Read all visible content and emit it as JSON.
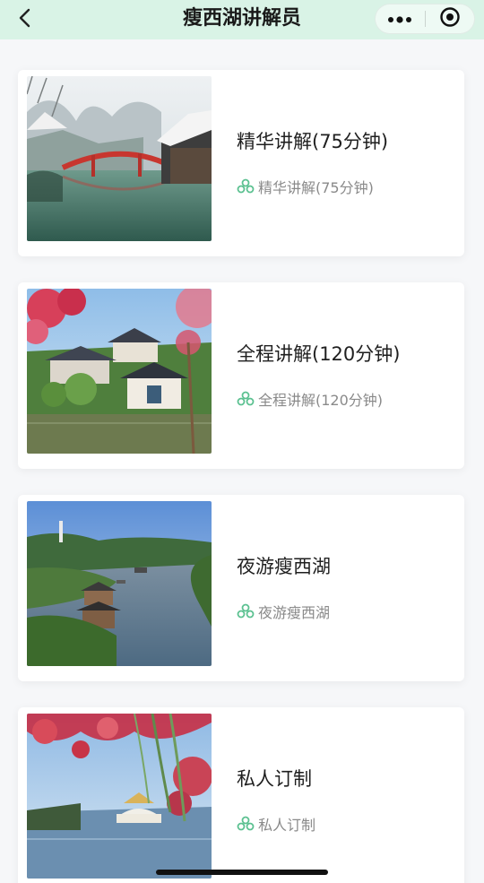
{
  "navbar": {
    "title": "瘦西湖讲解员",
    "back_icon": "back-icon",
    "more_icon": "more-icon",
    "close_icon": "target-icon"
  },
  "accent_color": "#5cc191",
  "items": [
    {
      "title": "精华讲解(75分钟)",
      "subtitle": "精华讲解(75分钟)",
      "thumbnail": "snowy-bridge-lake"
    },
    {
      "title": "全程讲解(120分钟)",
      "subtitle": "全程讲解(120分钟)",
      "thumbnail": "pavilion-blossoms"
    },
    {
      "title": "夜游瘦西湖",
      "subtitle": "夜游瘦西湖",
      "thumbnail": "lake-river-aerial"
    },
    {
      "title": "私人订制",
      "subtitle": "私人订制",
      "thumbnail": "blossom-bridge"
    }
  ]
}
